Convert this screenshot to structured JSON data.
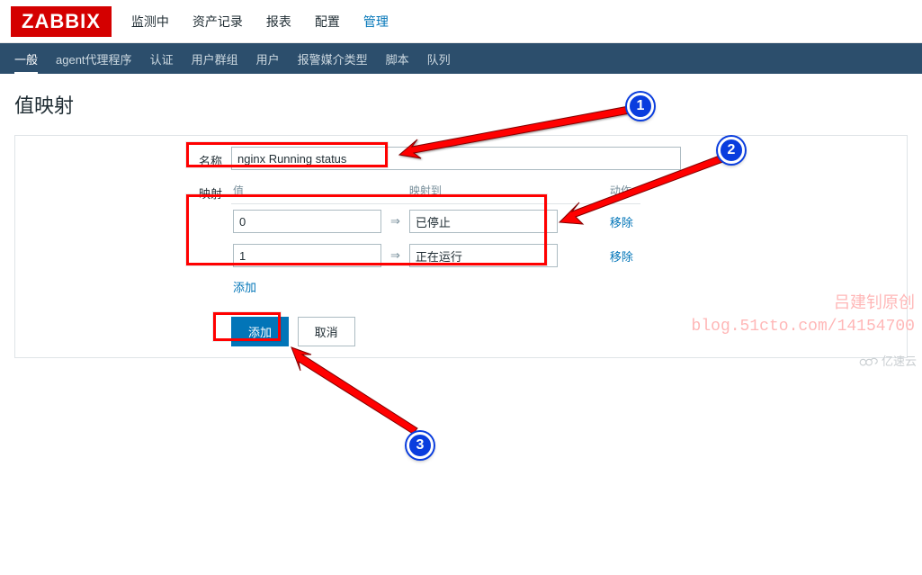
{
  "logo": "ZABBIX",
  "topnav": {
    "items": [
      "监测中",
      "资产记录",
      "报表",
      "配置",
      "管理"
    ],
    "active_index": 4
  },
  "subnav": {
    "items": [
      "一般",
      "agent代理程序",
      "认证",
      "用户群组",
      "用户",
      "报警媒介类型",
      "脚本",
      "队列"
    ],
    "active_index": 0
  },
  "page_title": "值映射",
  "form": {
    "name_label": "名称",
    "name_value": "nginx Running status",
    "mapping_label": "映射",
    "headers": {
      "value": "值",
      "mapped_to": "映射到",
      "action": "动作"
    },
    "arrow": "⇒",
    "rows": [
      {
        "value": "0",
        "mapped_to": "已停止",
        "remove": "移除"
      },
      {
        "value": "1",
        "mapped_to": "正在运行",
        "remove": "移除"
      }
    ],
    "add_link": "添加"
  },
  "buttons": {
    "submit": "添加",
    "cancel": "取消"
  },
  "annotations": {
    "b1": "1",
    "b2": "2",
    "b3": "3"
  },
  "watermark": {
    "line1": "吕建钊原创",
    "line2": "blog.51cto.com/14154700",
    "brand": "亿速云"
  }
}
